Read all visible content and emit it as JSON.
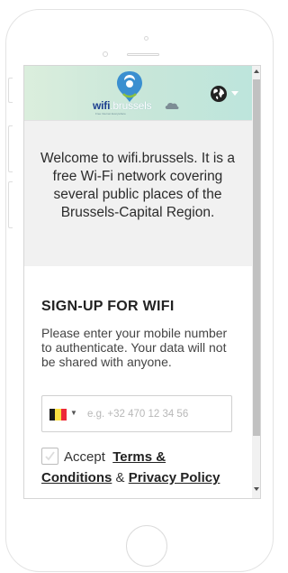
{
  "logo": {
    "wifi_text": "wifi",
    "rest_text": ".brussels",
    "tagline": "Free Internet Everywhere"
  },
  "header": {
    "language_icon": "globe-icon",
    "language_caret_icon": "caret-down-icon"
  },
  "intro": {
    "text": "Welcome to wifi.brussels. It is a free Wi-Fi network covering several public places of the Brussels-Capital Region."
  },
  "signup": {
    "title": "SIGN-UP FOR WIFI",
    "description": "Please enter your mobile number to authenticate. Your data will not be shared with anyone.",
    "country_flag": "belgium-flag",
    "flag_colors": [
      "#1a1a1a",
      "#fae042",
      "#ed2939"
    ],
    "phone_placeholder": "e.g. +32 470 12 34 56",
    "phone_value": "",
    "accept_label": "Accept",
    "terms_label": "Terms & Conditions",
    "and_label": "&",
    "privacy_label": "Privacy Policy",
    "accepted": false
  },
  "colors": {
    "header_gradient_start": "#dbeedd",
    "header_gradient_end": "#bde5dc",
    "intro_background": "#f1f1f1",
    "logo_blue": "#1d3f8f"
  }
}
